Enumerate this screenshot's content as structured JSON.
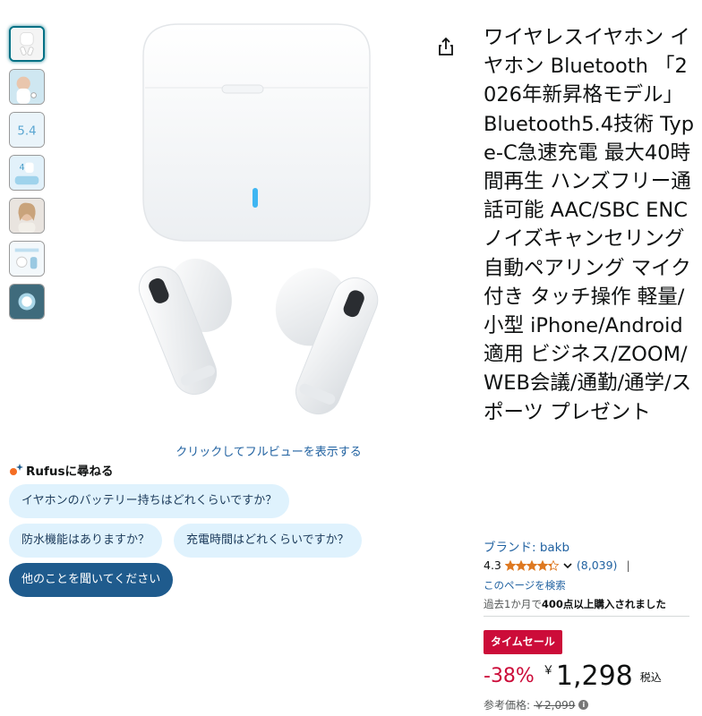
{
  "gallery": {
    "thumbnails": [
      {
        "name": "thumb-case-earbuds",
        "active": true
      },
      {
        "name": "thumb-person-wearing"
      },
      {
        "name": "thumb-bluetooth-5-4"
      },
      {
        "name": "thumb-battery-40h"
      },
      {
        "name": "thumb-woman-portrait"
      },
      {
        "name": "thumb-features"
      },
      {
        "name": "thumb-video"
      }
    ],
    "click_hint": "クリックしてフルビューを表示する"
  },
  "rufus": {
    "title": "Rufusに尋ねる",
    "questions": [
      "イヤホンのバッテリー持ちはどれくらいですか？",
      "防水機能はありますか？",
      "充電時間はどれくらいですか？"
    ],
    "ask_other": "他のことを聞いてください"
  },
  "product": {
    "title": "ワイヤレスイヤホン イヤホン Bluetooth 「2026年新昇格モデル」 Bluetooth5.4技術 Type-C急速充電 最大40時間再生 ハンズフリー通話可能 AAC/SBC ENCノイズキャンセリング 自動ペアリング マイク付き タッチ操作 軽量/小型 iPhone/Android適用 ビジネス/ZOOM/WEB会議/通勤/通学/スポーツ プレゼント",
    "brand": "ブランド: bakb",
    "rating": "4.3",
    "rating_value": 4.3,
    "review_count": "(8,039)",
    "pipe": "|",
    "search_page": "このページを検索",
    "bought_prefix": "過去1か月で",
    "bought_bold": "400点以上購入されました",
    "sale_badge": "タイムセール",
    "discount": "-38%",
    "currency": "￥",
    "price": "1,298",
    "tax": "税込",
    "ref_label": "参考価格:",
    "ref_price": "￥2,099",
    "info_icon": "i"
  },
  "colors": {
    "link": "#2162a1",
    "sale": "#cc0c39",
    "star": "#de7921",
    "chip_bg": "#dff2fd",
    "chip_dark": "#1f5b8d"
  },
  "icons": {
    "share": "share-icon",
    "rufus": "rufus-sparkle-icon",
    "star": "star-icon",
    "chevron": "chevron-down-icon",
    "info": "info-icon"
  }
}
